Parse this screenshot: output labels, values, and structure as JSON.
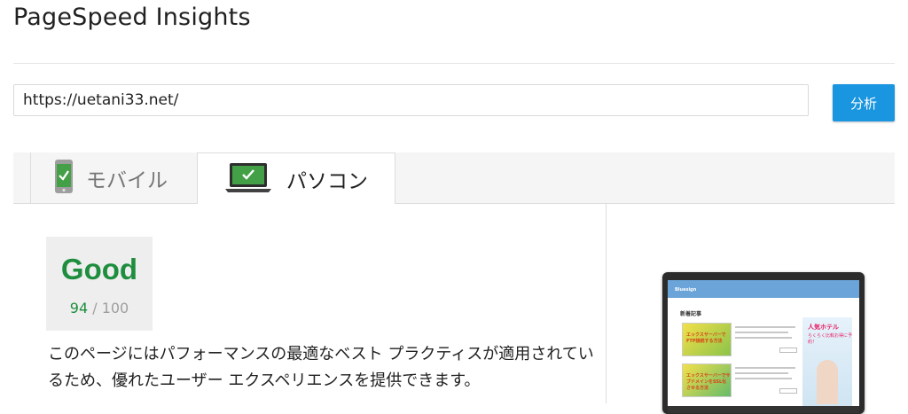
{
  "app": {
    "title": "PageSpeed Insights"
  },
  "search": {
    "url_value": "https://uetani33.net/",
    "analyze_label": "分析"
  },
  "tabs": [
    {
      "label": "モバイル",
      "icon": "mobile-phone-icon",
      "selected": false
    },
    {
      "label": "パソコン",
      "icon": "laptop-icon",
      "selected": true
    }
  ],
  "result": {
    "rating": "Good",
    "score": "94",
    "score_max": "/ 100",
    "summary": "このページにはパフォーマンスの最適なベスト プラクティスが適用されているため、優れたユーザー エクスペリエンスを提供できます。",
    "rating_color": "#1e8e3e"
  },
  "preview": {
    "site_logo": "Bluesign",
    "site_section_title": "新着記事",
    "thumb1_text": "エックスサーバーでFTP接続する方法",
    "thumb2_text": "エックスサーバーでサブドメインをSSL化させる方法",
    "ad_title": "人気ホテル",
    "ad_sub": "らくらく比較お得に予約！"
  },
  "colors": {
    "accent": "#1a95e0",
    "good": "#1e8e3e",
    "tab_bg": "#f5f5f5"
  }
}
